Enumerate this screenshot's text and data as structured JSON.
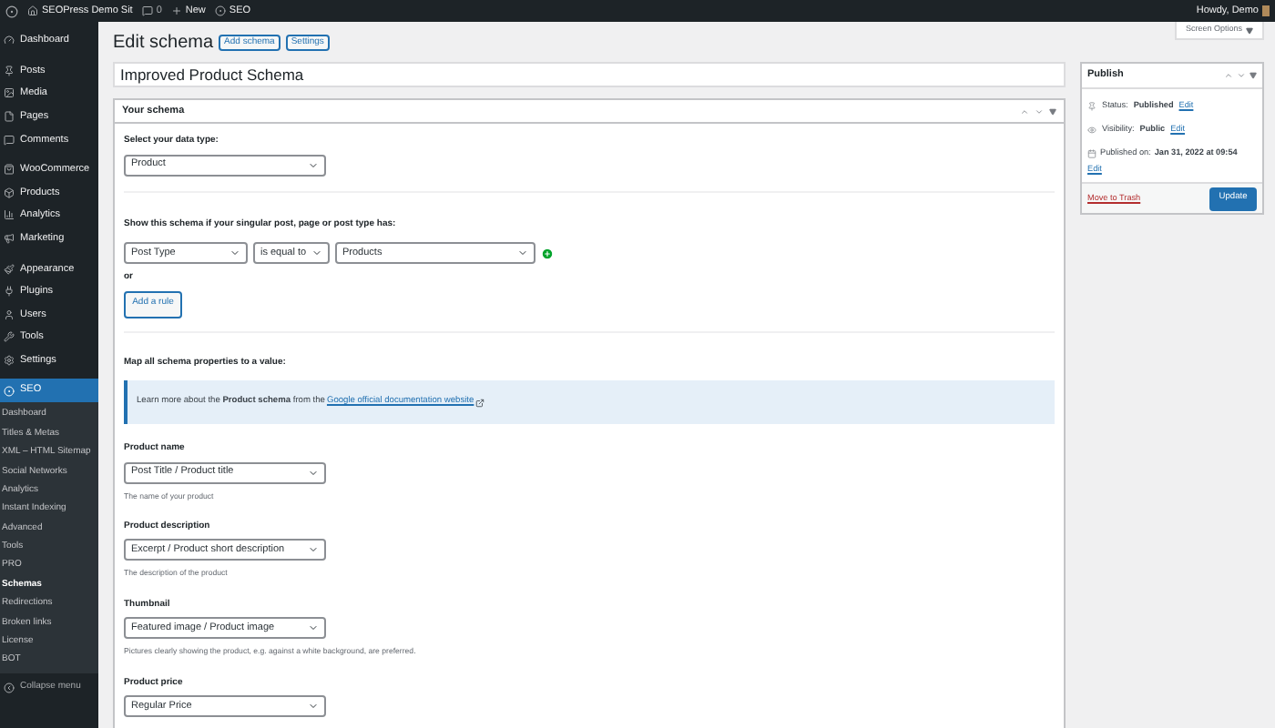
{
  "admin_bar": {
    "site_title": "SEOPress Demo Sit",
    "comments_count": "0",
    "new_label": "New",
    "seo_label": "SEO",
    "greeting": "Howdy, Demo"
  },
  "sidebar": {
    "groups": [
      [
        {
          "label": "Dashboard",
          "selected": false
        }
      ],
      [
        {
          "label": "Posts",
          "selected": false
        },
        {
          "label": "Media",
          "selected": false
        },
        {
          "label": "Pages",
          "selected": false
        },
        {
          "label": "Comments",
          "selected": false
        }
      ],
      [
        {
          "label": "WooCommerce",
          "selected": false
        },
        {
          "label": "Products",
          "selected": false
        },
        {
          "label": "Analytics",
          "selected": false
        },
        {
          "label": "Marketing",
          "selected": false
        }
      ],
      [
        {
          "label": "Appearance",
          "selected": false
        },
        {
          "label": "Plugins",
          "selected": false
        },
        {
          "label": "Users",
          "selected": false
        },
        {
          "label": "Tools",
          "selected": false
        },
        {
          "label": "Settings",
          "selected": false
        }
      ],
      [
        {
          "label": "SEO",
          "selected": true
        }
      ]
    ],
    "submenu": [
      {
        "label": "Dashboard",
        "selected": false
      },
      {
        "label": "Titles & Metas",
        "selected": false
      },
      {
        "label": "XML – HTML Sitemap",
        "selected": false
      },
      {
        "label": "Social Networks",
        "selected": false
      },
      {
        "label": "Analytics",
        "selected": false
      },
      {
        "label": "Instant Indexing",
        "selected": false
      },
      {
        "label": "Advanced",
        "selected": false
      },
      {
        "label": "Tools",
        "selected": false
      },
      {
        "label": "PRO",
        "selected": false
      },
      {
        "label": "Schemas",
        "selected": true
      },
      {
        "label": "Redirections",
        "selected": false
      },
      {
        "label": "Broken links",
        "selected": false
      },
      {
        "label": "License",
        "selected": false
      },
      {
        "label": "BOT",
        "selected": false
      }
    ],
    "collapse_label": "Collapse menu"
  },
  "screen_options": "Screen Options",
  "heading": {
    "title": "Edit schema",
    "buttons": [
      "Add schema",
      "Settings"
    ]
  },
  "title_field": {
    "value": "Improved Product Schema"
  },
  "schema_panel": {
    "title": "Your schema",
    "data_type": {
      "label": "Select your data type:",
      "value": "Product"
    },
    "rules": {
      "label": "Show this schema if your singular post, page or post type has:",
      "field": "Post Type",
      "operator": "is equal to",
      "value": "Products",
      "or_label": "or",
      "add_button": "Add a rule"
    },
    "mapping": {
      "label": "Map all schema properties to a value:",
      "notice": "Learn more about the **Product schema** from the ",
      "notice_link": "Google official documentation website"
    },
    "properties": [
      {
        "label": "Product name",
        "value": "Post Title / Product title",
        "help": "The name of your product"
      },
      {
        "label": "Product description",
        "value": "Excerpt / Product short description",
        "help": "The description of the product"
      },
      {
        "label": "Thumbnail",
        "value": "Featured image / Product image",
        "help": "Pictures clearly showing the product, e.g. against a white background, are preferred."
      },
      {
        "label": "Product price",
        "value": "Regular Price"
      }
    ]
  },
  "publish": {
    "title": "Publish",
    "status_label": "Status:",
    "status": "Published",
    "visibility_label": "Visibility:",
    "visibility": "Public",
    "published_label": "Published on:",
    "published_date": "Jan 31, 2022 at 09:54",
    "edit_links": [
      "Edit",
      "Edit",
      "Edit"
    ],
    "trash": "Move to Trash",
    "update": "Update"
  }
}
